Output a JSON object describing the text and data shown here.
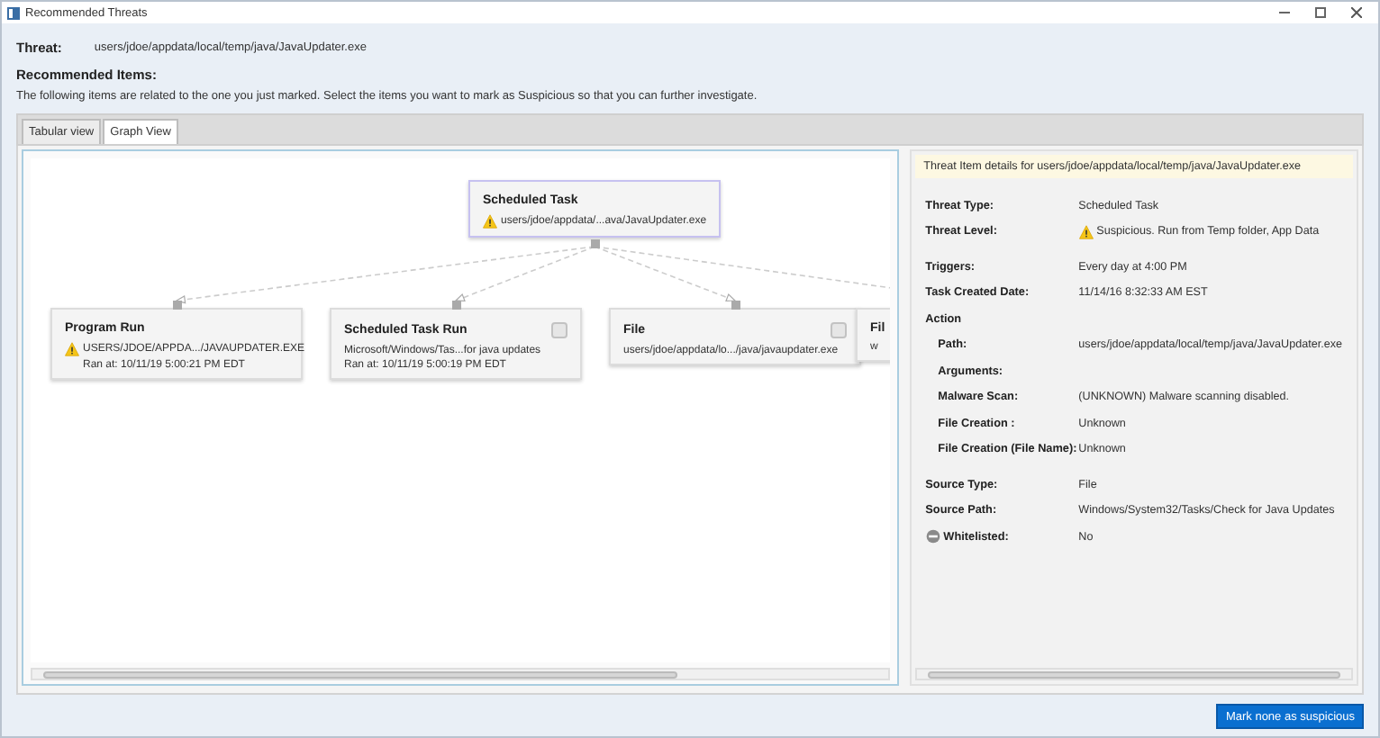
{
  "window": {
    "title": "Recommended Threats"
  },
  "threat": {
    "label": "Threat:",
    "value": "users/jdoe/appdata/local/temp/java/JavaUpdater.exe"
  },
  "recommended": {
    "heading": "Recommended Items:",
    "description": "The following items are related to the one you just marked. Select the items you want to mark as Suspicious so that you can further investigate."
  },
  "tabs": [
    {
      "label": "Tabular view",
      "selected": false
    },
    {
      "label": "Graph View",
      "selected": true
    }
  ],
  "graph": {
    "root": {
      "title": "Scheduled Task",
      "lines": [
        "users/jdoe/appdata/...ava/JavaUpdater.exe"
      ],
      "warning": true
    },
    "children": [
      {
        "title": "Program Run",
        "lines": [
          "USERS/JDOE/APPDA.../JAVAUPDATER.EXE",
          "Ran at: 10/11/19 5:00:21 PM EDT"
        ],
        "warning": true
      },
      {
        "title": "Scheduled Task Run",
        "lines": [
          "Microsoft/Windows/Tas...for java updates",
          "Ran at: 10/11/19 5:00:19 PM EDT"
        ],
        "warning": false,
        "checked": false
      },
      {
        "title": "File",
        "lines": [
          "users/jdoe/appdata/lo.../java/javaupdater.exe"
        ],
        "warning": false,
        "checked": false
      },
      {
        "title": "Fil",
        "lines": [
          "w"
        ],
        "warning": false
      }
    ]
  },
  "details": {
    "header": "Threat Item details for users/jdoe/appdata/local/temp/java/JavaUpdater.exe",
    "rows": [
      {
        "kind": "field",
        "label": "Threat Type:",
        "value": "Scheduled Task"
      },
      {
        "kind": "warning_field",
        "label": "Threat Level:",
        "value": "Suspicious. Run from Temp folder, App Data"
      },
      {
        "kind": "gap"
      },
      {
        "kind": "field",
        "label": "Triggers:",
        "value": "Every day at 4:00 PM"
      },
      {
        "kind": "field",
        "label": "Task Created Date:",
        "value": "11/14/16 8:32:33 AM EST"
      },
      {
        "kind": "section",
        "label": "Action"
      },
      {
        "kind": "subfield",
        "label": "Path:",
        "value": "users/jdoe/appdata/local/temp/java/JavaUpdater.exe"
      },
      {
        "kind": "subfield",
        "label": "Arguments:"
      },
      {
        "kind": "subfield",
        "label": "Malware Scan:",
        "value": "(UNKNOWN) Malware scanning disabled."
      },
      {
        "kind": "subfield",
        "label": "File Creation :",
        "value": "Unknown"
      },
      {
        "kind": "subfield",
        "label": "File Creation (File Name):",
        "value": "Unknown"
      },
      {
        "kind": "gap"
      },
      {
        "kind": "field",
        "label": "Source Type:",
        "value": "File"
      },
      {
        "kind": "field",
        "label": "Source Path:",
        "value": "Windows/System32/Tasks/Check for Java Updates"
      },
      {
        "kind": "status_field",
        "label": "Whitelisted:",
        "value": "No"
      }
    ]
  },
  "action_button": "Mark none as suspicious"
}
